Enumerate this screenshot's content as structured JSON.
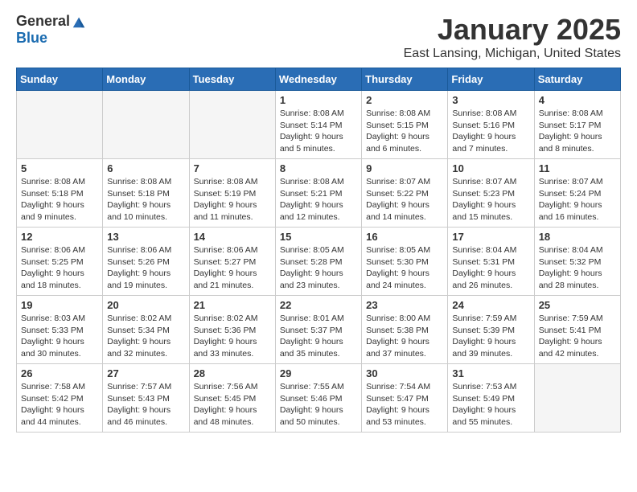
{
  "header": {
    "logo_general": "General",
    "logo_blue": "Blue",
    "month_title": "January 2025",
    "location": "East Lansing, Michigan, United States"
  },
  "weekdays": [
    "Sunday",
    "Monday",
    "Tuesday",
    "Wednesday",
    "Thursday",
    "Friday",
    "Saturday"
  ],
  "weeks": [
    [
      {
        "day": "",
        "sunrise": "",
        "sunset": "",
        "daylight": ""
      },
      {
        "day": "",
        "sunrise": "",
        "sunset": "",
        "daylight": ""
      },
      {
        "day": "",
        "sunrise": "",
        "sunset": "",
        "daylight": ""
      },
      {
        "day": "1",
        "sunrise": "Sunrise: 8:08 AM",
        "sunset": "Sunset: 5:14 PM",
        "daylight": "Daylight: 9 hours and 5 minutes."
      },
      {
        "day": "2",
        "sunrise": "Sunrise: 8:08 AM",
        "sunset": "Sunset: 5:15 PM",
        "daylight": "Daylight: 9 hours and 6 minutes."
      },
      {
        "day": "3",
        "sunrise": "Sunrise: 8:08 AM",
        "sunset": "Sunset: 5:16 PM",
        "daylight": "Daylight: 9 hours and 7 minutes."
      },
      {
        "day": "4",
        "sunrise": "Sunrise: 8:08 AM",
        "sunset": "Sunset: 5:17 PM",
        "daylight": "Daylight: 9 hours and 8 minutes."
      }
    ],
    [
      {
        "day": "5",
        "sunrise": "Sunrise: 8:08 AM",
        "sunset": "Sunset: 5:18 PM",
        "daylight": "Daylight: 9 hours and 9 minutes."
      },
      {
        "day": "6",
        "sunrise": "Sunrise: 8:08 AM",
        "sunset": "Sunset: 5:18 PM",
        "daylight": "Daylight: 9 hours and 10 minutes."
      },
      {
        "day": "7",
        "sunrise": "Sunrise: 8:08 AM",
        "sunset": "Sunset: 5:19 PM",
        "daylight": "Daylight: 9 hours and 11 minutes."
      },
      {
        "day": "8",
        "sunrise": "Sunrise: 8:08 AM",
        "sunset": "Sunset: 5:21 PM",
        "daylight": "Daylight: 9 hours and 12 minutes."
      },
      {
        "day": "9",
        "sunrise": "Sunrise: 8:07 AM",
        "sunset": "Sunset: 5:22 PM",
        "daylight": "Daylight: 9 hours and 14 minutes."
      },
      {
        "day": "10",
        "sunrise": "Sunrise: 8:07 AM",
        "sunset": "Sunset: 5:23 PM",
        "daylight": "Daylight: 9 hours and 15 minutes."
      },
      {
        "day": "11",
        "sunrise": "Sunrise: 8:07 AM",
        "sunset": "Sunset: 5:24 PM",
        "daylight": "Daylight: 9 hours and 16 minutes."
      }
    ],
    [
      {
        "day": "12",
        "sunrise": "Sunrise: 8:06 AM",
        "sunset": "Sunset: 5:25 PM",
        "daylight": "Daylight: 9 hours and 18 minutes."
      },
      {
        "day": "13",
        "sunrise": "Sunrise: 8:06 AM",
        "sunset": "Sunset: 5:26 PM",
        "daylight": "Daylight: 9 hours and 19 minutes."
      },
      {
        "day": "14",
        "sunrise": "Sunrise: 8:06 AM",
        "sunset": "Sunset: 5:27 PM",
        "daylight": "Daylight: 9 hours and 21 minutes."
      },
      {
        "day": "15",
        "sunrise": "Sunrise: 8:05 AM",
        "sunset": "Sunset: 5:28 PM",
        "daylight": "Daylight: 9 hours and 23 minutes."
      },
      {
        "day": "16",
        "sunrise": "Sunrise: 8:05 AM",
        "sunset": "Sunset: 5:30 PM",
        "daylight": "Daylight: 9 hours and 24 minutes."
      },
      {
        "day": "17",
        "sunrise": "Sunrise: 8:04 AM",
        "sunset": "Sunset: 5:31 PM",
        "daylight": "Daylight: 9 hours and 26 minutes."
      },
      {
        "day": "18",
        "sunrise": "Sunrise: 8:04 AM",
        "sunset": "Sunset: 5:32 PM",
        "daylight": "Daylight: 9 hours and 28 minutes."
      }
    ],
    [
      {
        "day": "19",
        "sunrise": "Sunrise: 8:03 AM",
        "sunset": "Sunset: 5:33 PM",
        "daylight": "Daylight: 9 hours and 30 minutes."
      },
      {
        "day": "20",
        "sunrise": "Sunrise: 8:02 AM",
        "sunset": "Sunset: 5:34 PM",
        "daylight": "Daylight: 9 hours and 32 minutes."
      },
      {
        "day": "21",
        "sunrise": "Sunrise: 8:02 AM",
        "sunset": "Sunset: 5:36 PM",
        "daylight": "Daylight: 9 hours and 33 minutes."
      },
      {
        "day": "22",
        "sunrise": "Sunrise: 8:01 AM",
        "sunset": "Sunset: 5:37 PM",
        "daylight": "Daylight: 9 hours and 35 minutes."
      },
      {
        "day": "23",
        "sunrise": "Sunrise: 8:00 AM",
        "sunset": "Sunset: 5:38 PM",
        "daylight": "Daylight: 9 hours and 37 minutes."
      },
      {
        "day": "24",
        "sunrise": "Sunrise: 7:59 AM",
        "sunset": "Sunset: 5:39 PM",
        "daylight": "Daylight: 9 hours and 39 minutes."
      },
      {
        "day": "25",
        "sunrise": "Sunrise: 7:59 AM",
        "sunset": "Sunset: 5:41 PM",
        "daylight": "Daylight: 9 hours and 42 minutes."
      }
    ],
    [
      {
        "day": "26",
        "sunrise": "Sunrise: 7:58 AM",
        "sunset": "Sunset: 5:42 PM",
        "daylight": "Daylight: 9 hours and 44 minutes."
      },
      {
        "day": "27",
        "sunrise": "Sunrise: 7:57 AM",
        "sunset": "Sunset: 5:43 PM",
        "daylight": "Daylight: 9 hours and 46 minutes."
      },
      {
        "day": "28",
        "sunrise": "Sunrise: 7:56 AM",
        "sunset": "Sunset: 5:45 PM",
        "daylight": "Daylight: 9 hours and 48 minutes."
      },
      {
        "day": "29",
        "sunrise": "Sunrise: 7:55 AM",
        "sunset": "Sunset: 5:46 PM",
        "daylight": "Daylight: 9 hours and 50 minutes."
      },
      {
        "day": "30",
        "sunrise": "Sunrise: 7:54 AM",
        "sunset": "Sunset: 5:47 PM",
        "daylight": "Daylight: 9 hours and 53 minutes."
      },
      {
        "day": "31",
        "sunrise": "Sunrise: 7:53 AM",
        "sunset": "Sunset: 5:49 PM",
        "daylight": "Daylight: 9 hours and 55 minutes."
      },
      {
        "day": "",
        "sunrise": "",
        "sunset": "",
        "daylight": ""
      }
    ]
  ]
}
